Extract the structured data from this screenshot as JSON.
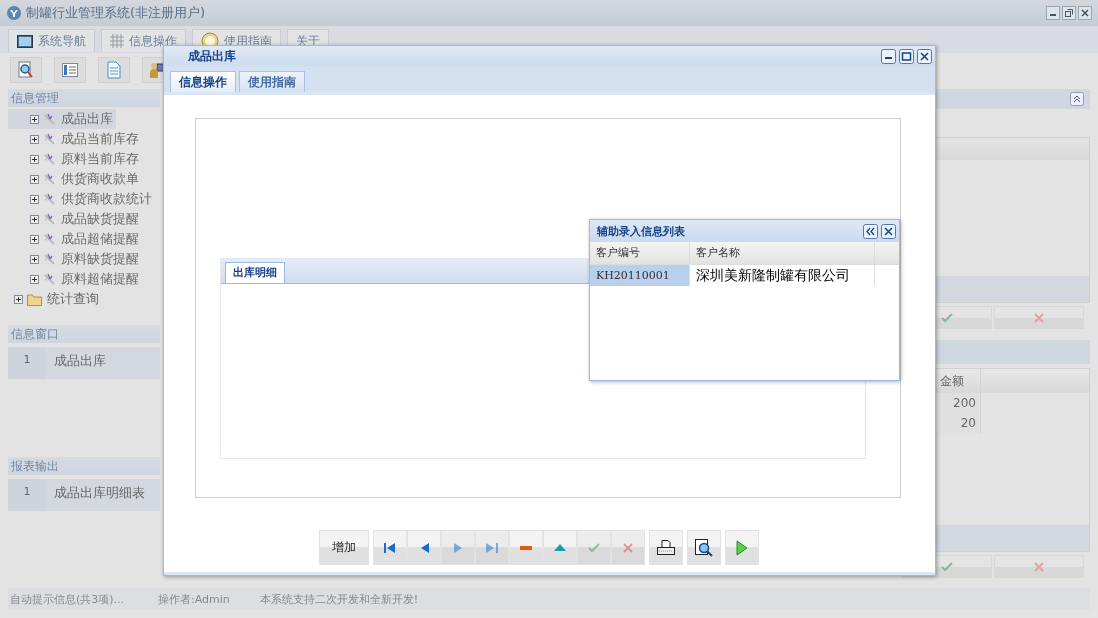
{
  "app": {
    "title": "制罐行业管理系统(非注册用户)",
    "tabs": [
      {
        "label": "系统导航",
        "kind": "monitor"
      },
      {
        "label": "信息操作",
        "kind": "grid"
      },
      {
        "label": "使用指南",
        "kind": "clock"
      },
      {
        "label": "关于",
        "kind": "none"
      }
    ],
    "toolbar": [
      {
        "kind": "search"
      },
      {
        "kind": "list"
      },
      {
        "kind": "document"
      },
      {
        "kind": "user"
      }
    ]
  },
  "sidebar": {
    "tree_title": "信息管理",
    "tree": [
      {
        "label": "成品出库",
        "kind": "tool",
        "expanded": false,
        "selected": true
      },
      {
        "label": "成品当前库存",
        "kind": "tool",
        "expanded": false,
        "selected": false
      },
      {
        "label": "原料当前库存",
        "kind": "tool",
        "expanded": false,
        "selected": false
      },
      {
        "label": "供货商收款单",
        "kind": "tool",
        "expanded": false,
        "selected": false
      },
      {
        "label": "供货商收款统计",
        "kind": "tool",
        "expanded": false,
        "selected": false
      },
      {
        "label": "成品缺货提醒",
        "kind": "tool",
        "expanded": false,
        "selected": false
      },
      {
        "label": "成品超储提醒",
        "kind": "tool",
        "expanded": false,
        "selected": false
      },
      {
        "label": "原料缺货提醒",
        "kind": "tool",
        "expanded": false,
        "selected": false
      },
      {
        "label": "原料超储提醒",
        "kind": "tool",
        "expanded": false,
        "selected": false
      },
      {
        "label": "统计查询",
        "kind": "folder",
        "expanded": false,
        "selected": false
      }
    ],
    "windows_title": "信息窗口",
    "windows": [
      {
        "index": "1",
        "name": "成品出库"
      }
    ],
    "reports_title": "报表输出",
    "reports": [
      {
        "index": "1",
        "name": "成品出库明细表"
      }
    ]
  },
  "main": {
    "columns": [
      "金额"
    ],
    "rows": [
      "200",
      "20"
    ]
  },
  "status_bar": [
    "自动提示信息(共3项)...",
    "操作者:Admin",
    "本系统支持二次开发和全新开发!"
  ],
  "dialog": {
    "title": "成品出库",
    "tabs": [
      {
        "label": "信息操作",
        "selected": true
      },
      {
        "label": "使用指南",
        "selected": false
      }
    ],
    "detail_tab": "出库明细",
    "buttons": [
      {
        "kind": "text",
        "label": "增加",
        "disabled": false
      },
      {
        "kind": "first",
        "disabled": false
      },
      {
        "kind": "prev",
        "disabled": false
      },
      {
        "kind": "next",
        "disabled": true
      },
      {
        "kind": "last",
        "disabled": true
      },
      {
        "kind": "minus",
        "disabled": false
      },
      {
        "kind": "up",
        "disabled": false
      },
      {
        "kind": "check",
        "disabled": true
      },
      {
        "kind": "cross",
        "disabled": true
      },
      {
        "kind": "print",
        "disabled": false
      },
      {
        "kind": "preview",
        "disabled": false
      },
      {
        "kind": "play",
        "disabled": false
      }
    ]
  },
  "lookup": {
    "title": "辅助录入信息列表",
    "columns": [
      "客户编号",
      "客户名称"
    ],
    "rows": [
      {
        "cells": [
          "KH20110001",
          "深圳美新隆制罐有限公司"
        ],
        "selected": true
      }
    ]
  }
}
